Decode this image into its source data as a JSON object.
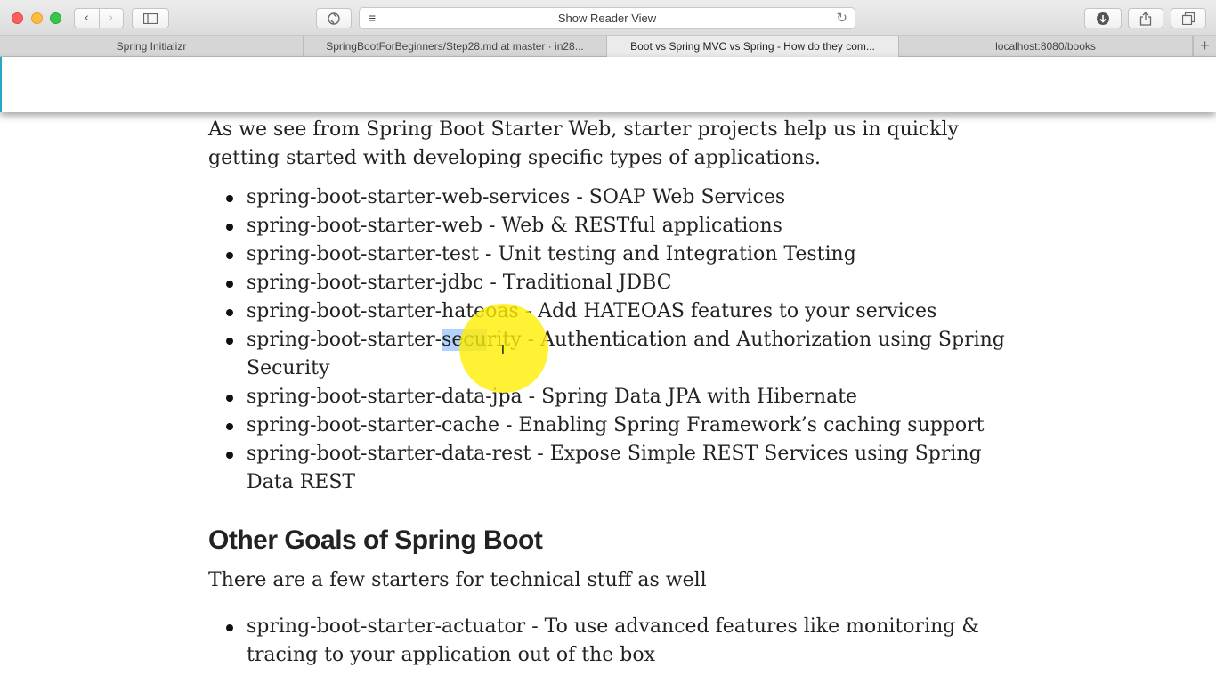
{
  "toolbar": {
    "back_icon": "chevron-left",
    "forward_icon": "chevron-right",
    "url_text": "Show Reader View"
  },
  "tabs": [
    {
      "label": "Spring Initializr",
      "active": false
    },
    {
      "label": "SpringBootForBeginners/Step28.md at master · in28...",
      "active": false
    },
    {
      "label": "Boot vs Spring MVC vs Spring - How do they com...",
      "active": true
    },
    {
      "label": "localhost:8080/books",
      "active": false
    }
  ],
  "article": {
    "intro": "As we see from Spring Boot Starter Web, starter projects help us in quickly getting started with developing specific types of applications.",
    "starters": [
      {
        "name": "spring-boot-starter-web-services",
        "desc": "SOAP Web Services"
      },
      {
        "name": "spring-boot-starter-web",
        "desc": "Web & RESTful applications"
      },
      {
        "name": "spring-boot-starter-test",
        "desc": "Unit testing and Integration Testing"
      },
      {
        "name": "spring-boot-starter-jdbc",
        "desc": "Traditional JDBC"
      },
      {
        "name": "spring-boot-starter-hateoas",
        "desc": "Add HATEOAS features to your services"
      },
      {
        "name": "spring-boot-starter-data-jpa",
        "desc": "Spring Data JPA with Hibernate"
      },
      {
        "name": "spring-boot-starter-cache",
        "desc": "Enabling Spring Framework’s caching support"
      },
      {
        "name": "spring-boot-starter-data-rest",
        "desc": "Expose Simple REST Services using Spring Data REST"
      }
    ],
    "security_item": {
      "prefix": "spring-boot-starter-",
      "highlight_part": "secu",
      "rest_part": "rity",
      "desc": "Authentication and Authorization using Spring Security"
    },
    "heading": "Other Goals of Spring Boot",
    "goals_intro": "There are a few starters for technical stuff as well",
    "technical_starters": [
      {
        "name": "spring-boot-starter-actuator",
        "desc": "To use advanced features like monitoring & tracing to your application out of the box"
      }
    ]
  },
  "separator": " - ",
  "colors": {
    "selection": "#b3d2ff",
    "cursor_halo": "#ffee00"
  }
}
